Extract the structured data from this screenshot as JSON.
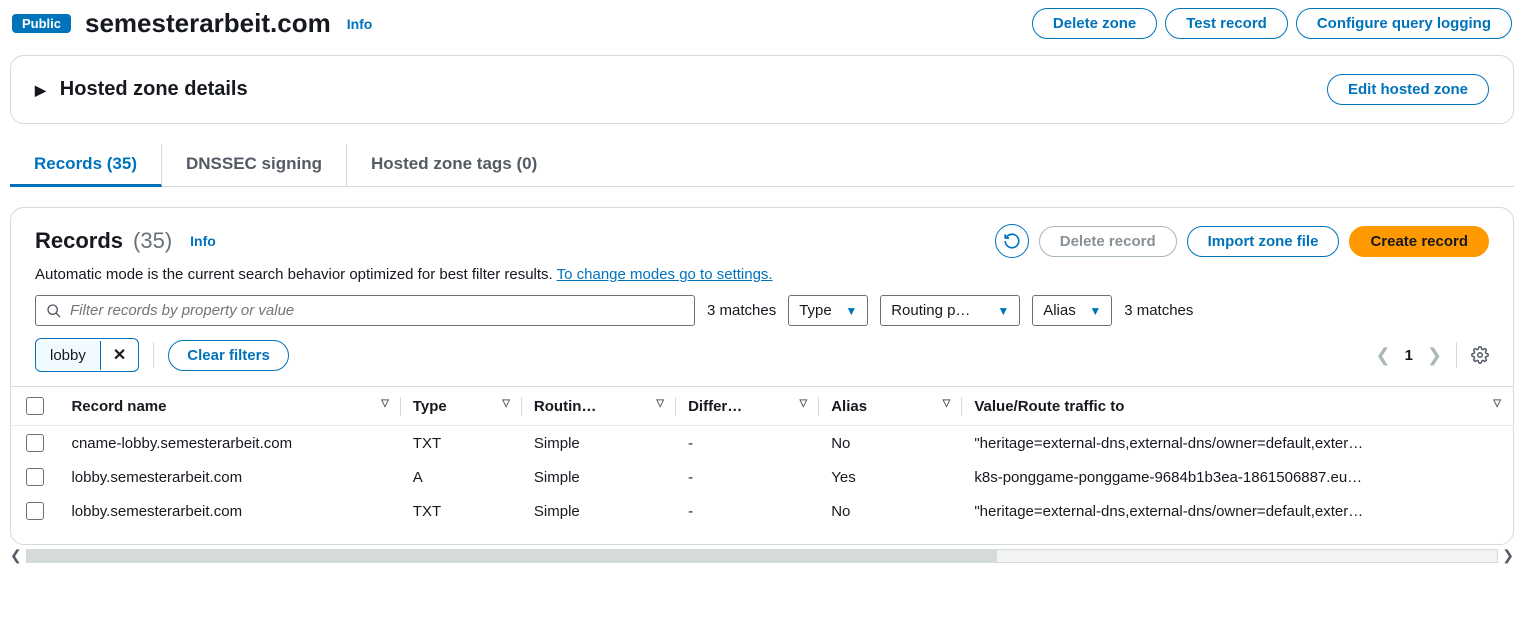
{
  "header": {
    "badge": "Public",
    "zone_name": "semesterarbeit.com",
    "info": "Info",
    "delete_zone": "Delete zone",
    "test_record": "Test record",
    "configure_logging": "Configure query logging"
  },
  "details_panel": {
    "title": "Hosted zone details",
    "edit": "Edit hosted zone"
  },
  "tabs": {
    "records": "Records (35)",
    "dnssec": "DNSSEC signing",
    "tags": "Hosted zone tags (0)"
  },
  "records_section": {
    "title": "Records",
    "count": "(35)",
    "info": "Info",
    "delete_record": "Delete record",
    "import_zone": "Import zone file",
    "create_record": "Create record",
    "subtext_a": "Automatic mode is the current search behavior optimized for best filter results. ",
    "subtext_link": "To change modes go to settings."
  },
  "filters": {
    "placeholder": "Filter records by property or value",
    "matches_left": "3 matches",
    "type_label": "Type",
    "routing_label": "Routing p…",
    "alias_label": "Alias",
    "matches_right": "3 matches",
    "token": "lobby",
    "clear": "Clear filters",
    "page": "1"
  },
  "columns": {
    "name": "Record name",
    "type": "Type",
    "routing": "Routin…",
    "diff": "Differ…",
    "alias": "Alias",
    "value": "Value/Route traffic to"
  },
  "rows": [
    {
      "name": "cname-lobby.semesterarbeit.com",
      "type": "TXT",
      "routing": "Simple",
      "diff": "-",
      "alias": "No",
      "value": "\"heritage=external-dns,external-dns/owner=default,exter…"
    },
    {
      "name": "lobby.semesterarbeit.com",
      "type": "A",
      "routing": "Simple",
      "diff": "-",
      "alias": "Yes",
      "value": "k8s-ponggame-ponggame-9684b1b3ea-1861506887.eu…"
    },
    {
      "name": "lobby.semesterarbeit.com",
      "type": "TXT",
      "routing": "Simple",
      "diff": "-",
      "alias": "No",
      "value": "\"heritage=external-dns,external-dns/owner=default,exter…"
    }
  ]
}
